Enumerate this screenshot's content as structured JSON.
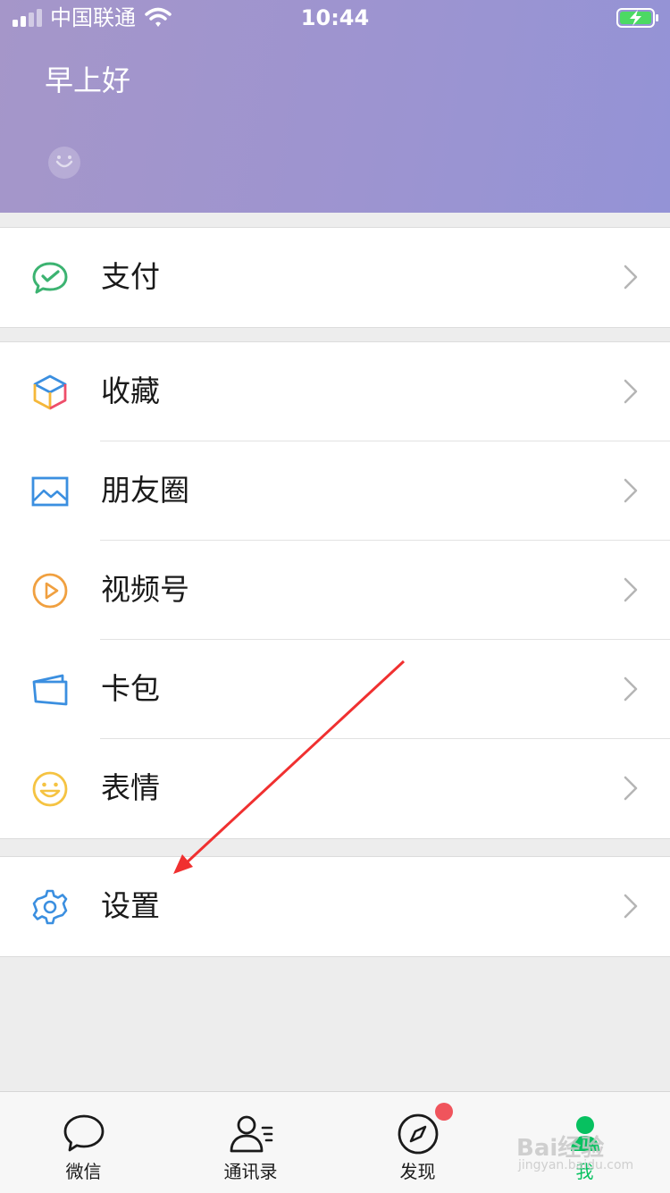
{
  "status_bar": {
    "carrier": "中国联通",
    "time": "10:44"
  },
  "header": {
    "greeting": "早上好"
  },
  "menu": {
    "pay": {
      "label": "支付",
      "icon": "pay-icon"
    },
    "favorites": {
      "label": "收藏",
      "icon": "cube-icon"
    },
    "moments": {
      "label": "朋友圈",
      "icon": "image-icon"
    },
    "channels": {
      "label": "视频号",
      "icon": "play-icon"
    },
    "card": {
      "label": "卡包",
      "icon": "wallet-icon"
    },
    "stickers": {
      "label": "表情",
      "icon": "smiley-icon"
    },
    "settings": {
      "label": "设置",
      "icon": "gear-icon"
    }
  },
  "tabbar": {
    "tabs": [
      {
        "label": "微信",
        "icon": "chat-bubble-icon"
      },
      {
        "label": "通讯录",
        "icon": "contacts-icon"
      },
      {
        "label": "发现",
        "icon": "compass-icon"
      },
      {
        "label": "我",
        "icon": "person-icon",
        "active": true
      }
    ]
  },
  "watermark": {
    "text": "Bai经验",
    "sub": "jingyan.baidu.com"
  },
  "colors": {
    "header_start": "#a596c9",
    "header_end": "#9493d6",
    "active_tab": "#07c160",
    "badge": "#f0545c",
    "arrow": "#f03030"
  }
}
